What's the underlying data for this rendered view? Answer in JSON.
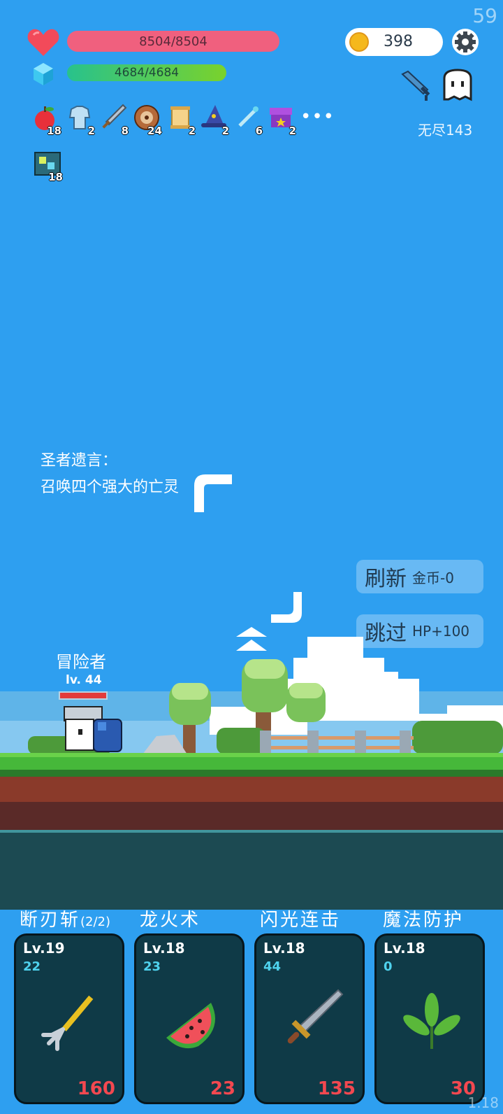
{
  "hud": {
    "fps": "59",
    "version": "1.18",
    "hp": "8504/8504",
    "mp": "4684/4684",
    "coins": "398",
    "endless": "无尽143"
  },
  "inventory": [
    {
      "icon": "apple-icon",
      "count": "18"
    },
    {
      "icon": "armor-icon",
      "count": "2"
    },
    {
      "icon": "sword-icon",
      "count": "8"
    },
    {
      "icon": "shield-icon",
      "count": "24"
    },
    {
      "icon": "scroll-icon",
      "count": "2"
    },
    {
      "icon": "wizard-hat-icon",
      "count": "2"
    },
    {
      "icon": "wand-icon",
      "count": "6"
    },
    {
      "icon": "chest-icon",
      "count": "2"
    }
  ],
  "inventory_more": "•••",
  "inventory_row2": {
    "icon": "rune-icon",
    "count": "18"
  },
  "message": {
    "title": "圣者遗言：",
    "body": "召唤四个强大的亡灵"
  },
  "actions": {
    "refresh_label": "刷新",
    "refresh_cost": "金币-0",
    "skip_label": "跳过",
    "skip_reward": "HP+100"
  },
  "hero": {
    "name": "冒险者",
    "level": "lv. 44"
  },
  "skills": [
    {
      "title": "断刃斩",
      "suffix": "(2/2)",
      "level": "Lv.19",
      "value": "22",
      "cost": "160",
      "icon": "trident-icon"
    },
    {
      "title": "龙火术",
      "suffix": "",
      "level": "Lv.18",
      "value": "23",
      "cost": "23",
      "icon": "watermelon-icon"
    },
    {
      "title": "闪光连击",
      "suffix": "",
      "level": "Lv.18",
      "value": "44",
      "cost": "135",
      "icon": "sword-icon"
    },
    {
      "title": "魔法防护",
      "suffix": "",
      "level": "Lv.18",
      "value": "0",
      "cost": "30",
      "icon": "leaf-icon"
    }
  ],
  "colors": {
    "sky": "#2e9ff0",
    "hp": "#f0607e",
    "mp": "#28c28c",
    "grass": "#46b83a",
    "soil": "#8a3a2a",
    "card": "#0f3a47",
    "cost": "#f34850"
  }
}
